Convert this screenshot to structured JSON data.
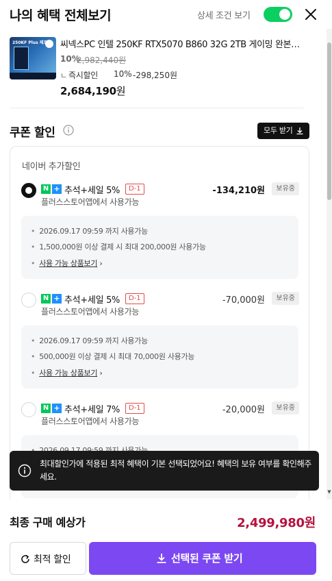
{
  "header": {
    "title": "나의 혜택 전체보기",
    "toggle_label": "상세 조건 보기",
    "toggle_on": true
  },
  "product": {
    "image_caption": "250KF Plus 제조",
    "name": "씨넥스PC 인텔 250KF RTX5070 B860 32G 2TB 게이밍 완본…",
    "discount_rate": "10%",
    "original_price": "2,982,440원",
    "instant_discount_mark": "ㄴ",
    "instant_discount_label": "즉시할인",
    "instant_discount_rate": "10%",
    "instant_discount_amount": "-298,250원",
    "final_price": "2,684,190",
    "final_price_unit": "원"
  },
  "coupons_section": {
    "title": "쿠폰 할인",
    "download_all_label": "모두 받기",
    "group_label": "네이버 추가할인",
    "items": [
      {
        "selected": true,
        "name": "추석+세일 5%",
        "dday": "D-1",
        "amount": "-134,210원",
        "status": "보유중",
        "sub": "플러스스토어앱에서 사용가능",
        "details": [
          "2026.09.17 09:59 까지 사용가능",
          "1,500,000원 이상 결제 시 최대 200,000원 사용가능"
        ],
        "link": "사용 가능 상품보기"
      },
      {
        "selected": false,
        "name": "추석+세일 5%",
        "dday": "D-1",
        "amount": "-70,000원",
        "status": "보유중",
        "sub": "플러스스토어앱에서 사용가능",
        "details": [
          "2026.09.17 09:59 까지 사용가능",
          "500,000원 이상 결제 시 최대 70,000원 사용가능"
        ],
        "link": "사용 가능 상품보기"
      },
      {
        "selected": false,
        "name": "추석+세일 7%",
        "dday": "D-1",
        "amount": "-20,000원",
        "status": "보유중",
        "sub": "플러스스토어앱에서 사용가능",
        "details": [
          "2026.09.17 09:59 까지 사용가능"
        ],
        "link": ""
      }
    ]
  },
  "toast": {
    "message": "최대할인가에 적용된 최적 혜택이 기본 선택되었어요! 혜택의 보유 여부를 확인해주세요."
  },
  "footer": {
    "final_label": "최종 구매 예상가",
    "final_amount": "2,499,980원",
    "best_button_label": "최적 할인",
    "get_button_label": "선택된 쿠폰 받기"
  },
  "colors": {
    "toggle": "#0bcf61",
    "primary_button": "#7c48f2",
    "final_price": "#b5123f",
    "naver_badge": "#03c75a",
    "dday": "#e34b4b"
  }
}
